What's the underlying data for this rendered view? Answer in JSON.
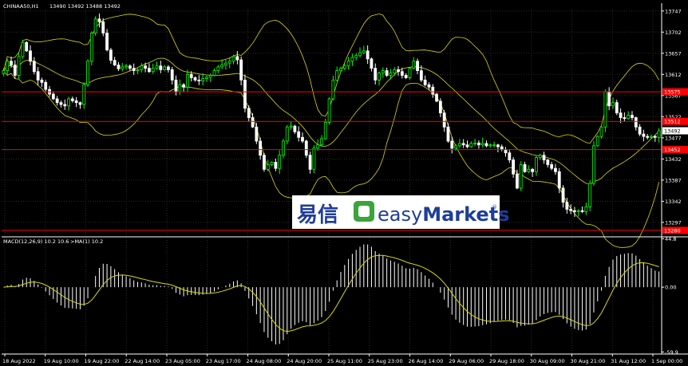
{
  "header": {
    "symbol_label": "CHINAA50,H1",
    "ohlc_label": "13490 13492 13488 13492"
  },
  "macd_label": {
    "indicator": "MACD(12,26,9) 10.2 10.6",
    "ma_label": ">MA(1) 10.2"
  },
  "watermark": {
    "left_text": "易信",
    "right_text": "easyMarkets",
    "easy": "easy",
    "markets": "Markets",
    "registered": "®"
  },
  "colors": {
    "background": "#000000",
    "grid": "#2b2b2b",
    "bull": "#00ff00",
    "bear": "#ffffff",
    "bands": "#d8d80a",
    "hline": "#ff0000",
    "axis_text": "#ffffff",
    "macd_hist": "#ffffff",
    "macd_signal": "#d8d80a",
    "brand_green": "#3aa53a",
    "brand_blue": "#1f3d9a"
  },
  "chart_data": [
    {
      "type": "candlestick",
      "symbol": "CHINAA50",
      "timeframe": "H1",
      "ylim": [
        13268,
        13750
      ],
      "y_ticks": [
        13747,
        13702,
        13657,
        13612,
        13567,
        13522,
        13477,
        13432,
        13387,
        13342,
        13297
      ],
      "x_tick_labels": [
        "18 Aug 2022",
        "19 Aug 10:00",
        "19 Aug 22:00",
        "22 Aug 14:00",
        "23 Aug 05:00",
        "23 Aug 17:00",
        "24 Aug 08:00",
        "24 Aug 20:00",
        "25 Aug 11:00",
        "25 Aug 23:00",
        "26 Aug 14:00",
        "29 Aug 06:00",
        "29 Aug 18:00",
        "30 Aug 09:00",
        "30 Aug 21:00",
        "31 Aug 12:00",
        "1 Sep 00:00"
      ],
      "horizontal_lines": [
        {
          "price": 13575,
          "label": "13575"
        },
        {
          "price": 13512,
          "label": "13512"
        },
        {
          "price": 13492,
          "label": "13492",
          "current": true
        },
        {
          "price": 13452,
          "label": "13452"
        },
        {
          "price": 13280,
          "label": "13280"
        }
      ],
      "close": [
        13620,
        13640,
        13632,
        13610,
        13650,
        13680,
        13662,
        13640,
        13618,
        13600,
        13595,
        13580,
        13570,
        13560,
        13552,
        13548,
        13545,
        13560,
        13556,
        13552,
        13548,
        13590,
        13640,
        13700,
        13730,
        13724,
        13700,
        13664,
        13642,
        13632,
        13624,
        13628,
        13630,
        13625,
        13620,
        13622,
        13630,
        13625,
        13618,
        13625,
        13630,
        13622,
        13628,
        13622,
        13600,
        13575,
        13590,
        13585,
        13612,
        13605,
        13600,
        13598,
        13603,
        13606,
        13610,
        13620,
        13628,
        13632,
        13636,
        13640,
        13650,
        13643,
        13600,
        13540,
        13520,
        13500,
        13470,
        13440,
        13410,
        13420,
        13425,
        13412,
        13440,
        13470,
        13500,
        13502,
        13490,
        13478,
        13470,
        13440,
        13410,
        13455,
        13462,
        13475,
        13510,
        13560,
        13600,
        13620,
        13625,
        13630,
        13640,
        13648,
        13652,
        13658,
        13662,
        13645,
        13625,
        13600,
        13615,
        13620,
        13610,
        13615,
        13622,
        13618,
        13610,
        13605,
        13625,
        13640,
        13620,
        13600,
        13590,
        13585,
        13570,
        13555,
        13530,
        13500,
        13470,
        13455,
        13460,
        13465,
        13462,
        13458,
        13465,
        13466,
        13462,
        13465,
        13460,
        13462,
        13462,
        13458,
        13452,
        13445,
        13430,
        13400,
        13370,
        13420,
        13405,
        13410,
        13405,
        13435,
        13440,
        13430,
        13420,
        13412,
        13405,
        13370,
        13340,
        13325,
        13322,
        13320,
        13322,
        13320,
        13330,
        13380,
        13460,
        13480,
        13500,
        13575,
        13545,
        13552,
        13530,
        13520,
        13518,
        13525,
        13520,
        13500,
        13485,
        13480,
        13478,
        13480,
        13478,
        13492
      ],
      "bands_period": 20,
      "bands_deviations": 2
    },
    {
      "type": "macd",
      "params": [
        12,
        26,
        9
      ],
      "values_shown": {
        "macd": 10.2,
        "signal": 10.6,
        "ma1": 10.2
      },
      "ylim": [
        -61.8,
        45.8
      ],
      "y_ticks": [
        44.8,
        0.0,
        -59.9
      ]
    }
  ]
}
